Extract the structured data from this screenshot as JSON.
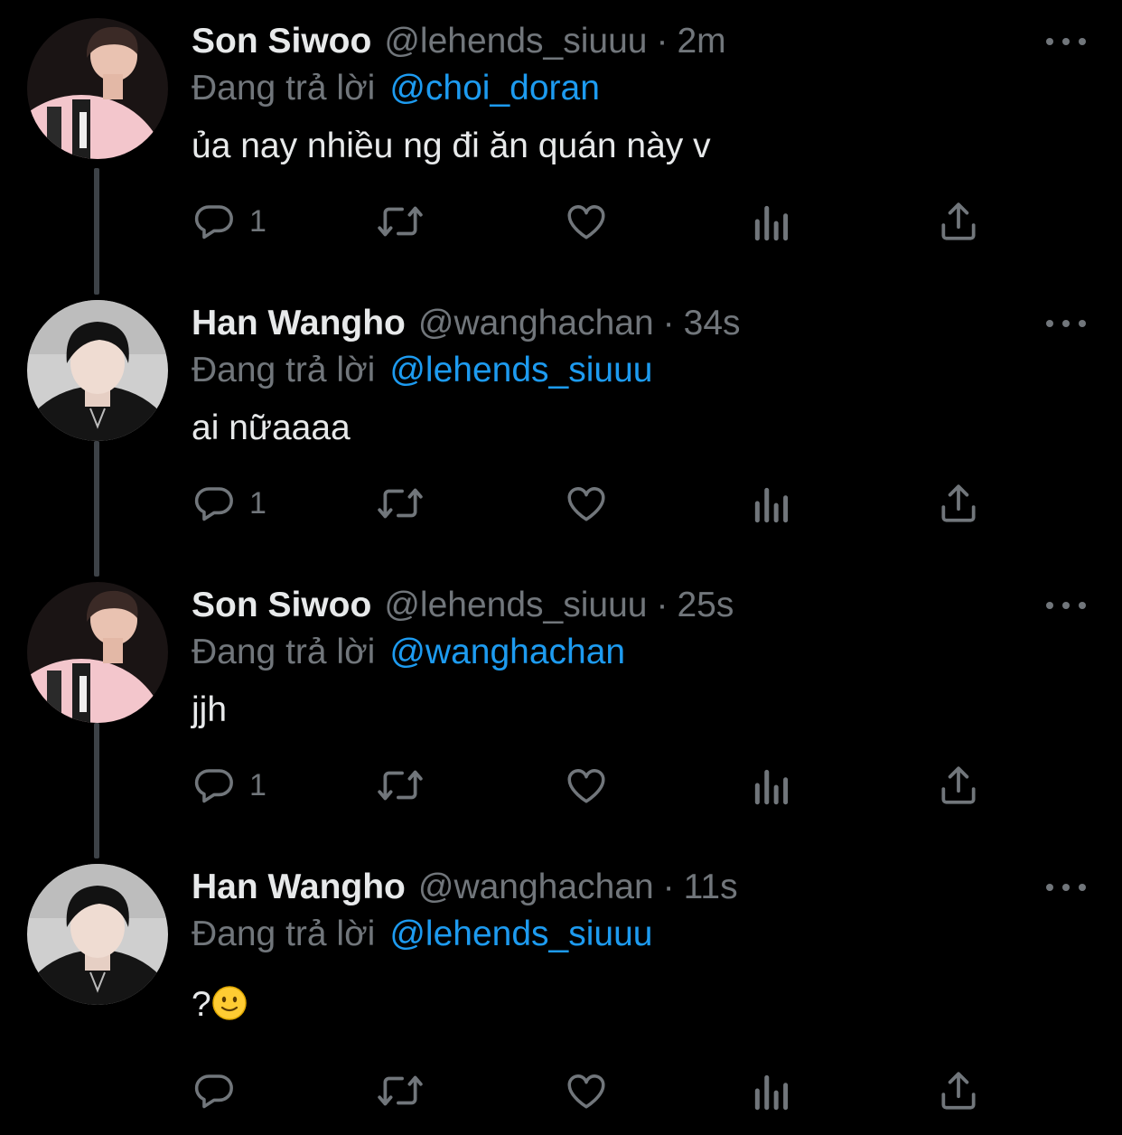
{
  "tweets": [
    {
      "display_name": "Son Siwoo",
      "handle": "@lehends_siuuu",
      "time": "2m",
      "replying_label": "Đang trả lời",
      "replying_to": "@choi_doran",
      "text": "ủa nay nhiều ng đi ăn quán này v",
      "reply_count": "1",
      "avatar": "son-siwoo"
    },
    {
      "display_name": "Han Wangho",
      "handle": "@wanghachan",
      "time": "34s",
      "replying_label": "Đang trả lời",
      "replying_to": "@lehends_siuuu",
      "text": "ai nữaaaa",
      "reply_count": "1",
      "avatar": "han-wangho"
    },
    {
      "display_name": "Son Siwoo",
      "handle": "@lehends_siuuu",
      "time": "25s",
      "replying_label": "Đang trả lời",
      "replying_to": "@wanghachan",
      "text": "jjh",
      "reply_count": "1",
      "avatar": "son-siwoo"
    },
    {
      "display_name": "Han Wangho",
      "handle": "@wanghachan",
      "time": "11s",
      "replying_label": "Đang trả lời",
      "replying_to": "@lehends_siuuu",
      "text": "?",
      "emoji": "slightly-smiling-face",
      "reply_count": "",
      "avatar": "han-wangho"
    }
  ],
  "separator": "·",
  "icons": {
    "reply": "reply-icon",
    "retweet": "retweet-icon",
    "like": "heart-icon",
    "views": "analytics-icon",
    "share": "share-icon",
    "more": "more-icon"
  },
  "colors": {
    "background": "#000000",
    "text": "#e7e9ea",
    "secondary": "#71767b",
    "link": "#1d9bf0",
    "thread_line": "#3d4247"
  }
}
